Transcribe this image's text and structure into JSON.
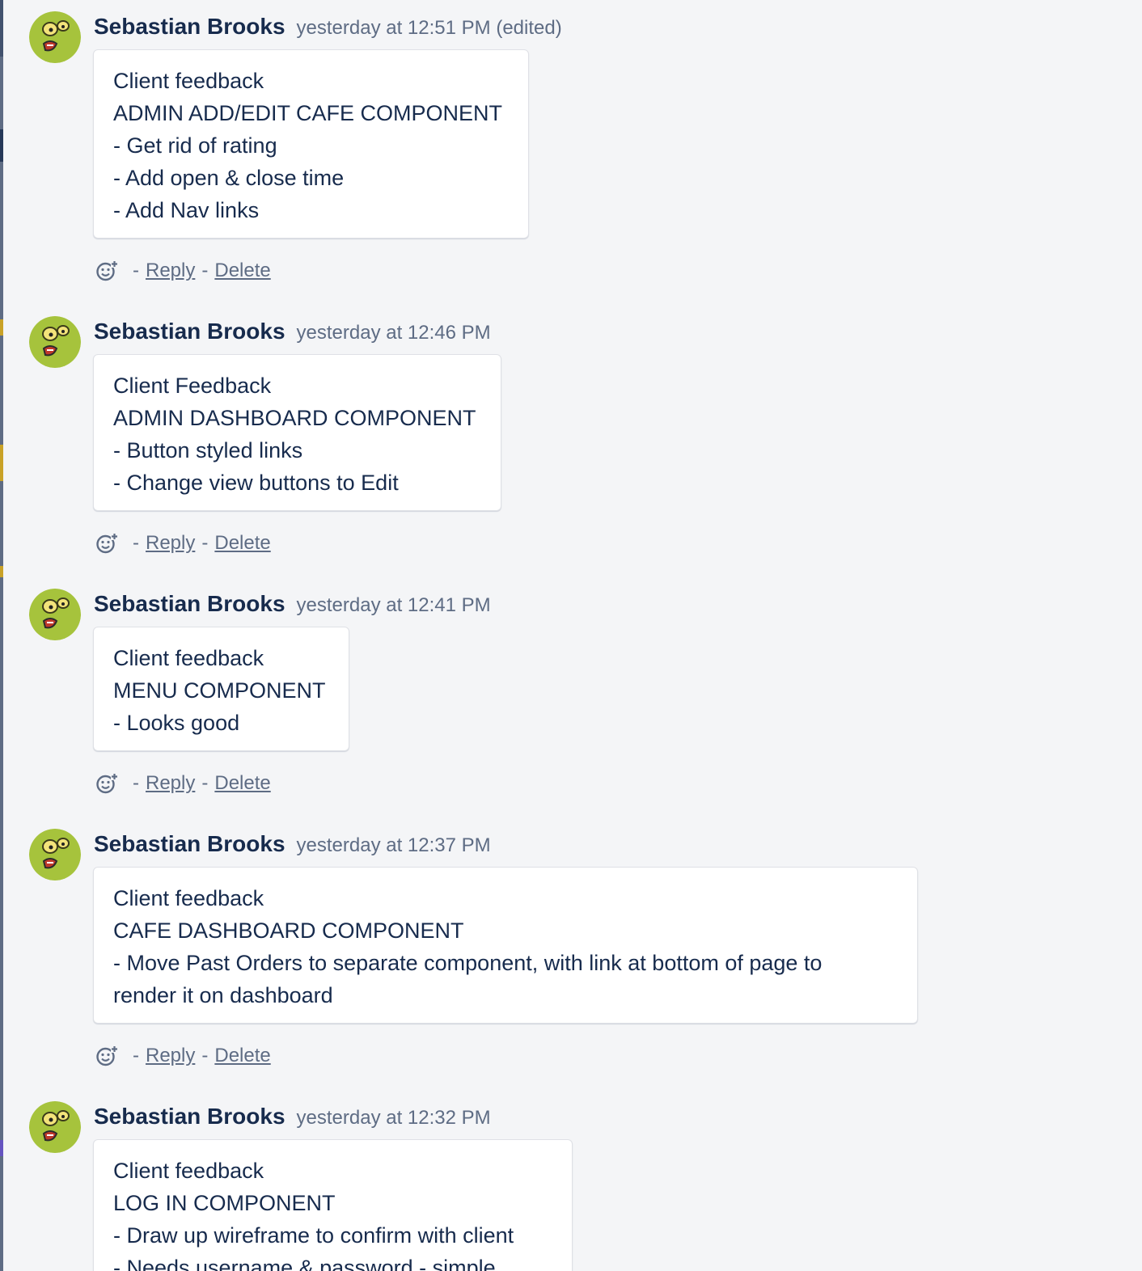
{
  "colors": {
    "page_background": "#f4f5f7",
    "card_background": "#ffffff",
    "author_text": "#172b4d",
    "meta_text": "#5e6c84",
    "avatar_green": "#a6c33c"
  },
  "actions": {
    "separator": "-",
    "reply_label": "Reply",
    "delete_label": "Delete",
    "react_icon": "add-reaction-icon"
  },
  "comments": [
    {
      "author": "Sebastian Brooks",
      "timestamp": "yesterday at 12:51 PM (edited)",
      "lines": [
        "Client feedback",
        "ADMIN ADD/EDIT CAFE COMPONENT",
        "- Get rid of rating",
        "- Add open & close time",
        "- Add Nav links"
      ]
    },
    {
      "author": "Sebastian Brooks",
      "timestamp": "yesterday at 12:46 PM",
      "lines": [
        "Client Feedback",
        "ADMIN DASHBOARD COMPONENT",
        "- Button styled links",
        "- Change view buttons to Edit"
      ]
    },
    {
      "author": "Sebastian Brooks",
      "timestamp": "yesterday at 12:41 PM",
      "lines": [
        "Client feedback",
        "MENU COMPONENT",
        "- Looks good"
      ]
    },
    {
      "author": "Sebastian Brooks",
      "timestamp": "yesterday at 12:37 PM",
      "lines": [
        "Client feedback",
        "CAFE DASHBOARD COMPONENT",
        "- Move Past Orders to separate component, with link at bottom of page to",
        "render it on dashboard"
      ]
    },
    {
      "author": "Sebastian Brooks",
      "timestamp": "yesterday at 12:32 PM",
      "lines": [
        "Client feedback",
        "LOG IN COMPONENT",
        "- Draw up wireframe to confirm with client",
        "- Needs username & password - simple"
      ]
    }
  ]
}
